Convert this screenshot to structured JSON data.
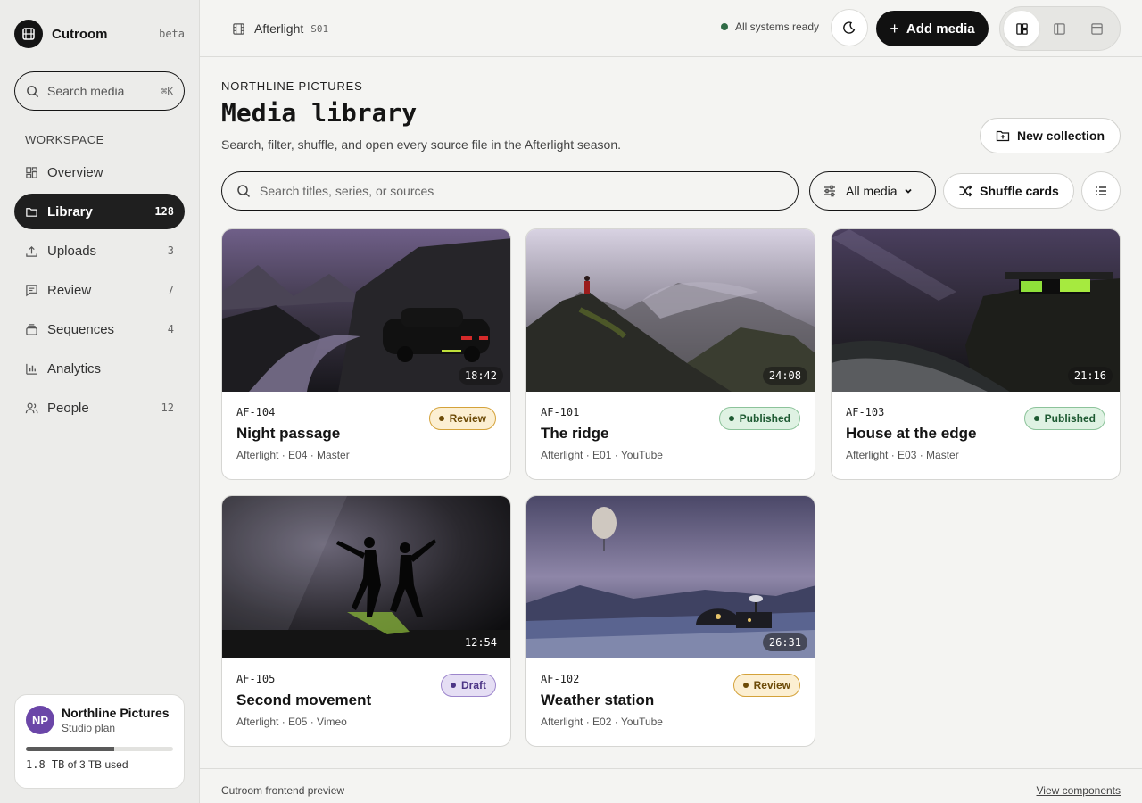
{
  "app": {
    "name": "Cutroom",
    "tag": "beta"
  },
  "sidebar": {
    "search": {
      "placeholder": "Search media",
      "shortcut": "⌘K"
    },
    "section_label": "WORKSPACE",
    "items": [
      {
        "label": "Overview",
        "count": "",
        "icon": "grid-icon"
      },
      {
        "label": "Library",
        "count": "128",
        "icon": "folder-icon",
        "active": true
      },
      {
        "label": "Uploads",
        "count": "3",
        "icon": "upload-icon"
      },
      {
        "label": "Review",
        "count": "7",
        "icon": "message-icon"
      },
      {
        "label": "Sequences",
        "count": "4",
        "icon": "layers-icon"
      },
      {
        "label": "Analytics",
        "count": "",
        "icon": "bar-chart-icon"
      },
      {
        "label": "People",
        "count": "12",
        "icon": "users-icon"
      }
    ],
    "account": {
      "initials": "NP",
      "name": "Northline Pictures",
      "plan": "Studio plan",
      "storage_used": "1.8 TB",
      "storage_total_text": " of 3 TB used",
      "storage_fraction": 0.6
    }
  },
  "topbar": {
    "project": "Afterlight",
    "season": "S01",
    "status": "All systems ready",
    "add_label": "Add media"
  },
  "main": {
    "eyebrow": "NORTHLINE PICTURES",
    "title": "Media library",
    "subtitle": "Search, filter, shuffle, and open every source file in the Afterlight season.",
    "new_collection": "New collection",
    "search_placeholder": "Search titles, series, or sources",
    "filter_label": "All media",
    "shuffle_label": "Shuffle cards"
  },
  "cards": [
    {
      "code": "AF-104",
      "title": "Night passage",
      "meta": "Afterlight · E04 · Master",
      "status": "Review",
      "duration": "18:42",
      "scene": "car"
    },
    {
      "code": "AF-101",
      "title": "The ridge",
      "meta": "Afterlight · E01 · YouTube",
      "status": "Published",
      "duration": "24:08",
      "scene": "ridge"
    },
    {
      "code": "AF-103",
      "title": "House at the edge",
      "meta": "Afterlight · E03 · Master",
      "status": "Published",
      "duration": "21:16",
      "scene": "house"
    },
    {
      "code": "AF-105",
      "title": "Second movement",
      "meta": "Afterlight · E05 · Vimeo",
      "status": "Draft",
      "duration": "12:54",
      "scene": "dance"
    },
    {
      "code": "AF-102",
      "title": "Weather station",
      "meta": "Afterlight · E02 · YouTube",
      "status": "Review",
      "duration": "26:31",
      "scene": "station"
    }
  ],
  "footer": {
    "left": "Cutroom frontend preview",
    "right": "View components"
  }
}
